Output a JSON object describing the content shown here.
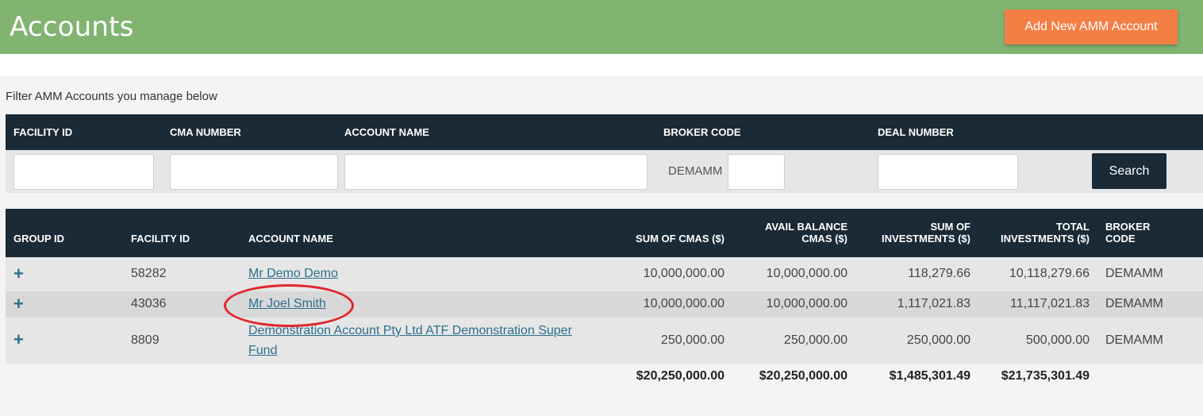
{
  "header": {
    "title": "Accounts",
    "add_button": "Add New AMM Account"
  },
  "filter": {
    "caption": "Filter AMM Accounts you manage below",
    "labels": {
      "facility_id": "FACILITY ID",
      "cma_number": "CMA NUMBER",
      "account_name": "ACCOUNT NAME",
      "broker_code": "BROKER CODE",
      "deal_number": "DEAL NUMBER"
    },
    "values": {
      "facility_id": "",
      "cma_number": "",
      "account_name": "",
      "broker_code": "",
      "deal_number": ""
    },
    "broker_prefix": "DEMAMM",
    "search_button": "Search"
  },
  "table": {
    "columns": {
      "group_id": "GROUP ID",
      "facility_id": "FACILITY ID",
      "account_name": "ACCOUNT NAME",
      "sum_cmas_1": "",
      "sum_cmas_2": "SUM OF CMAS ($)",
      "avail_1": "AVAIL BALANCE",
      "avail_2": "CMAS ($)",
      "sum_inv_1": "SUM OF",
      "sum_inv_2": "INVESTMENTS ($)",
      "total_inv_1": "TOTAL",
      "total_inv_2": "INVESTMENTS ($)",
      "broker_1": "BROKER",
      "broker_2": "CODE"
    },
    "rows": [
      {
        "expand": "+",
        "facility_id": "58282",
        "account_name": "Mr Demo Demo",
        "sum_cmas": "10,000,000.00",
        "avail_balance": "10,000,000.00",
        "sum_investments": "118,279.66",
        "total_investments": "10,118,279.66",
        "broker_code": "DEMAMM"
      },
      {
        "expand": "+",
        "facility_id": "43036",
        "account_name": "Mr Joel Smith",
        "sum_cmas": "10,000,000.00",
        "avail_balance": "10,000,000.00",
        "sum_investments": "1,117,021.83",
        "total_investments": "11,117,021.83",
        "broker_code": "DEMAMM"
      },
      {
        "expand": "+",
        "facility_id": "8809",
        "account_name_line1": "Demonstration Account Pty Ltd ATF Demonstration Super",
        "account_name_line2": "Fund",
        "sum_cmas": "250,000.00",
        "avail_balance": "250,000.00",
        "sum_investments": "250,000.00",
        "total_investments": "500,000.00",
        "broker_code": "DEMAMM"
      }
    ],
    "totals": {
      "sum_cmas": "$20,250,000.00",
      "avail_balance": "$20,250,000.00",
      "sum_investments": "$1,485,301.49",
      "total_investments": "$21,735,301.49"
    }
  },
  "colors": {
    "header_green": "#81b371",
    "accent_orange": "#f47f45",
    "dark_navy": "#1a2a36",
    "link_teal": "#2b6f8c",
    "annotation_red": "#e0262b"
  }
}
